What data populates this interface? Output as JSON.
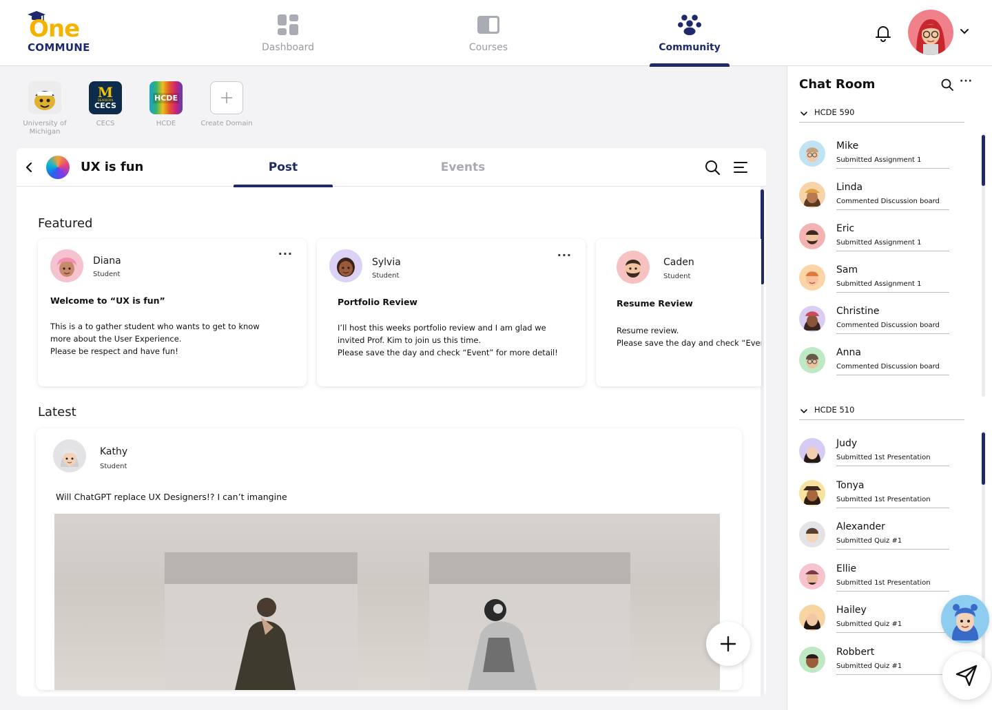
{
  "brand": {
    "name": "One",
    "sub": "COMMUNE"
  },
  "nav": [
    {
      "label": "Dashboard",
      "icon": "dashboard-icon",
      "active": false
    },
    {
      "label": "Courses",
      "icon": "book-icon",
      "active": false
    },
    {
      "label": "Community",
      "icon": "community-icon",
      "active": true
    }
  ],
  "domains": [
    {
      "label": "University of Michigan",
      "icon": "wolverine-logo",
      "active": false
    },
    {
      "label": "CECS",
      "icon": "cecs-logo",
      "active": false
    },
    {
      "label": "HCDE",
      "icon": "hcde-logo",
      "active": true
    },
    {
      "label": "Create Domain",
      "icon": "plus-icon",
      "active": false
    }
  ],
  "domain_logos": {
    "cecs_mark": "M",
    "cecs_small": "DEARBORN",
    "cecs_text": "CECS",
    "hcde_text": "HCDE"
  },
  "group": {
    "title": "UX is fun"
  },
  "tabs": [
    {
      "label": "Post",
      "active": true
    },
    {
      "label": "Events",
      "active": false
    }
  ],
  "featured": {
    "title": "Featured",
    "posts": [
      {
        "name": "Diana",
        "role": "Student",
        "title": "Welcome to “UX is fun”",
        "body": [
          "This is a to gather student who wants to get to know",
          "more about the User Experience.",
          "Please be respect and have fun!"
        ]
      },
      {
        "name": "Sylvia",
        "role": "Student",
        "title": "Portfolio Review",
        "body": [
          "I’ll host this weeks portfolio review and I am glad we",
          "invited Prof. Kim to join us this time.",
          "Please save the day and check “Event” for more detail!"
        ]
      },
      {
        "name": "Caden",
        "role": "Student",
        "title": "Resume Review",
        "body": [
          "Resume review.",
          "Please save the day and check “Event” for more detail!"
        ]
      }
    ]
  },
  "latest": {
    "title": "Latest",
    "post": {
      "name": "Kathy",
      "role": "Student",
      "text": "Will ChatGPT replace UX Designers!? I can’t imangine"
    }
  },
  "chat": {
    "title": "Chat Room",
    "groups": [
      {
        "name": "HCDE 590",
        "members": [
          {
            "name": "Mike",
            "status": "Submitted Assignment 1"
          },
          {
            "name": "Linda",
            "status": "Commented Discussion board"
          },
          {
            "name": "Eric",
            "status": "Submitted Assignment 1"
          },
          {
            "name": "Sam",
            "status": "Submitted Assignment 1"
          },
          {
            "name": "Christine",
            "status": "Commented Discussion board"
          },
          {
            "name": "Anna",
            "status": "Commented Discussion board"
          }
        ]
      },
      {
        "name": "HCDE 510",
        "members": [
          {
            "name": "Judy",
            "status": "Submitted 1st Presentation"
          },
          {
            "name": "Tonya",
            "status": "Submitted 1st Presentation"
          },
          {
            "name": "Alexander",
            "status": "Submitted Quiz #1"
          },
          {
            "name": "Ellie",
            "status": "Submitted 1st Presentation"
          },
          {
            "name": "Hailey",
            "status": "Submitted Quiz #1"
          },
          {
            "name": "Robbert",
            "status": "Submitted Quiz #1"
          }
        ]
      }
    ]
  },
  "colors": {
    "primary": "#1f2a6b",
    "brand_yellow": "#f5b300",
    "muted": "#a9a9b2"
  }
}
